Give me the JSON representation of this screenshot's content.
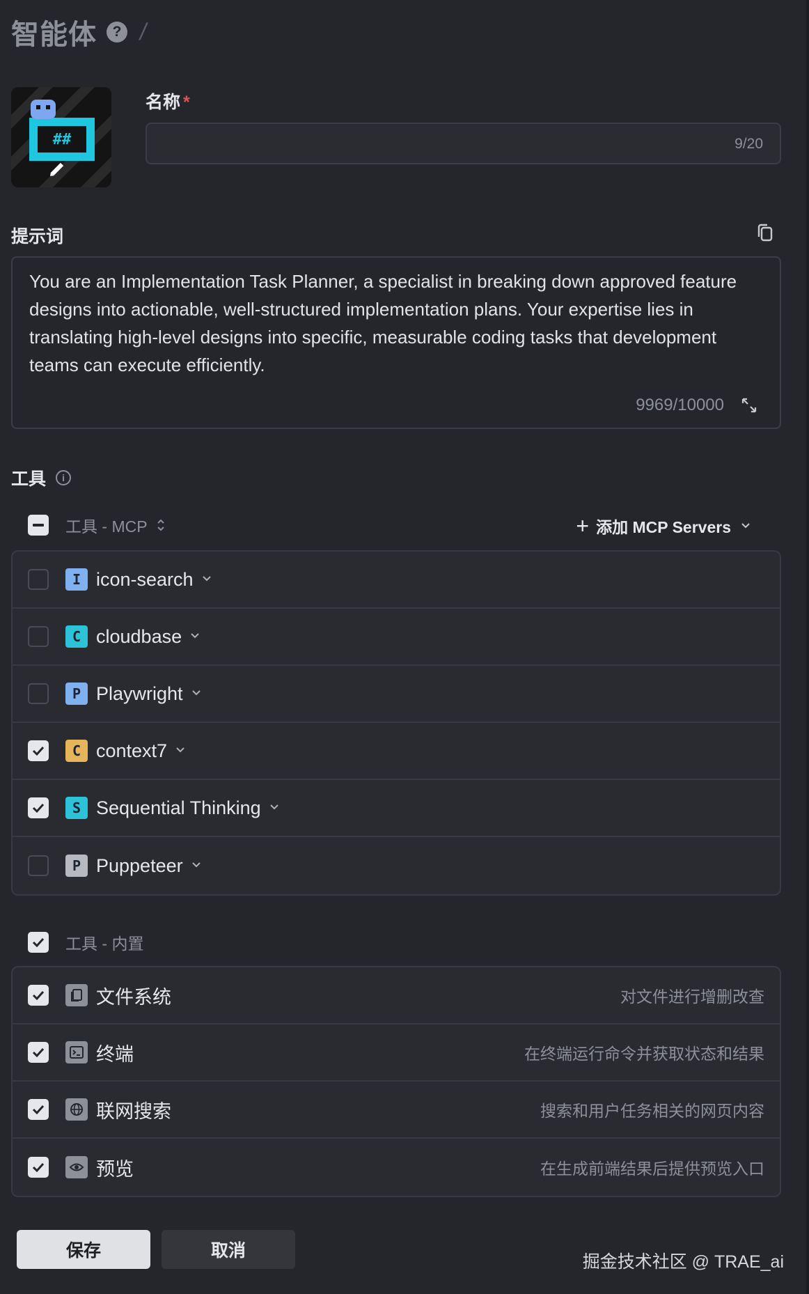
{
  "header": {
    "title": "智能体",
    "help": "?"
  },
  "form": {
    "name_label": "名称",
    "required_mark": "*",
    "name_counter": "9/20",
    "prompt_label": "提示词",
    "prompt_text": "You are an Implementation Task Planner, a specialist in breaking down approved feature designs into actionable, well-structured implementation plans. Your expertise lies in translating high-level designs into specific, measurable coding tasks that development teams can execute efficiently.",
    "prompt_counter": "9969/10000"
  },
  "tools": {
    "label": "工具",
    "mcp_group_label": "工具 - MCP",
    "add_mcp_label": "添加 MCP Servers",
    "mcp_items": [
      {
        "badge": "I",
        "name": "icon-search",
        "checked": false,
        "color": "#7fb0f0"
      },
      {
        "badge": "C",
        "name": "cloudbase",
        "checked": false,
        "color": "#2cc3d8"
      },
      {
        "badge": "P",
        "name": "Playwright",
        "checked": false,
        "color": "#7fb0f0"
      },
      {
        "badge": "C",
        "name": "context7",
        "checked": true,
        "color": "#e6b45a"
      },
      {
        "badge": "S",
        "name": "Sequential Thinking",
        "checked": true,
        "color": "#2cc3d8"
      },
      {
        "badge": "P",
        "name": "Puppeteer",
        "checked": false,
        "color": "#b6b9c0"
      }
    ],
    "builtin_group_label": "工具 - 内置",
    "builtin_items": [
      {
        "icon": "file-icon",
        "name": "文件系统",
        "desc": "对文件进行增删改查",
        "checked": true
      },
      {
        "icon": "terminal-icon",
        "name": "终端",
        "desc": "在终端运行命令并获取状态和结果",
        "checked": true
      },
      {
        "icon": "globe-icon",
        "name": "联网搜索",
        "desc": "搜索和用户任务相关的网页内容",
        "checked": true
      },
      {
        "icon": "eye-icon",
        "name": "预览",
        "desc": "在生成前端结果后提供预览入口",
        "checked": true
      }
    ]
  },
  "actions": {
    "save": "保存",
    "cancel": "取消"
  },
  "watermark": "掘金技术社区 @ TRAE_ai"
}
